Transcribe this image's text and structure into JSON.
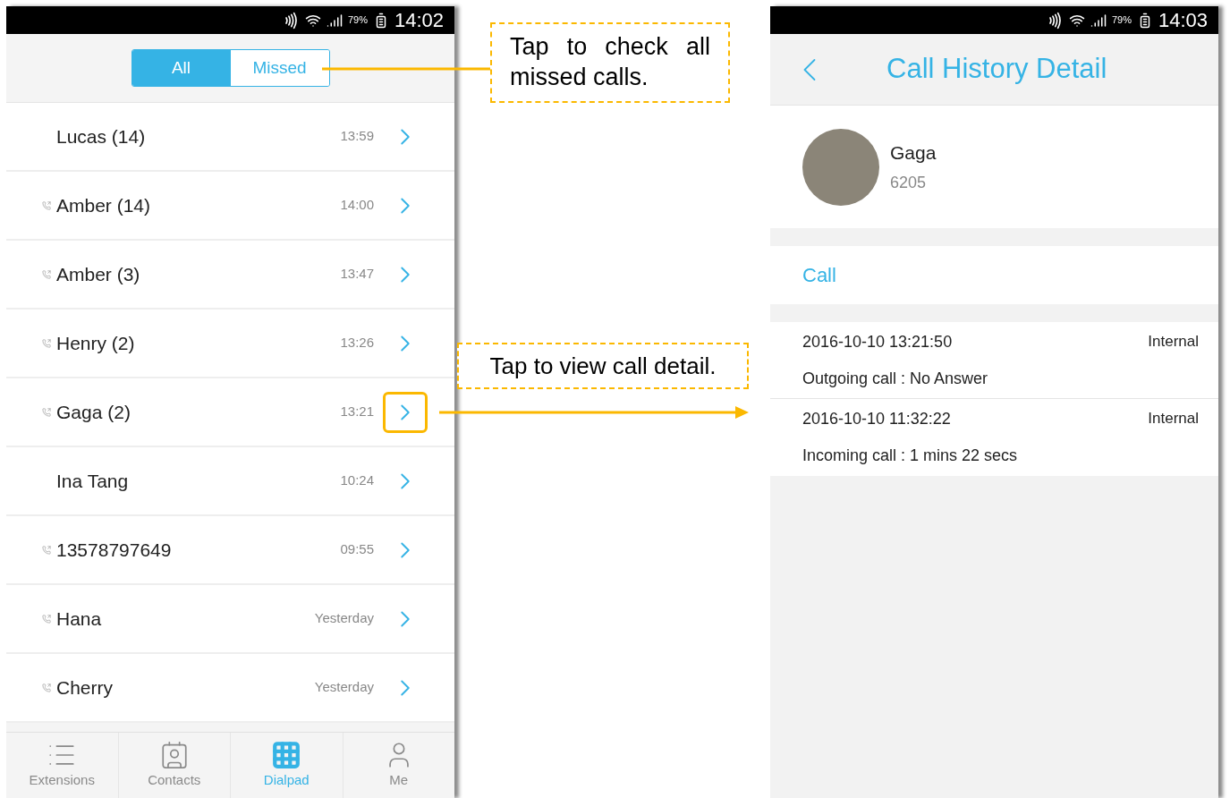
{
  "list_screen": {
    "status_bar": {
      "battery": "79%",
      "time": "14:02"
    },
    "filter_tabs": [
      {
        "label": "All",
        "selected": true
      },
      {
        "label": "Missed",
        "selected": false
      }
    ],
    "calls": [
      {
        "name": "Lucas (14)",
        "time": "13:59",
        "outgoing": false,
        "highlighted": false
      },
      {
        "name": "Amber (14)",
        "time": "14:00",
        "outgoing": true,
        "highlighted": false
      },
      {
        "name": "Amber (3)",
        "time": "13:47",
        "outgoing": true,
        "highlighted": false
      },
      {
        "name": "Henry (2)",
        "time": "13:26",
        "outgoing": true,
        "highlighted": false
      },
      {
        "name": "Gaga (2)",
        "time": "13:21",
        "outgoing": true,
        "highlighted": true
      },
      {
        "name": "Ina Tang",
        "time": "10:24",
        "outgoing": false,
        "highlighted": false
      },
      {
        "name": "13578797649",
        "time": "09:55",
        "outgoing": true,
        "highlighted": false
      },
      {
        "name": "Hana",
        "time": "Yesterday",
        "outgoing": true,
        "highlighted": false
      },
      {
        "name": "Cherry",
        "time": "Yesterday",
        "outgoing": true,
        "highlighted": false
      }
    ],
    "nav": [
      {
        "kind": "list",
        "label": "Extensions",
        "selected": false
      },
      {
        "kind": "contacts",
        "label": "Contacts",
        "selected": false
      },
      {
        "kind": "dialpad",
        "label": "Dialpad",
        "selected": true
      },
      {
        "kind": "person",
        "label": "Me",
        "selected": false
      }
    ]
  },
  "callouts": [
    {
      "text": "Tap to check all missed calls."
    },
    {
      "text": "Tap to view call detail."
    }
  ],
  "detail_screen": {
    "status_bar": {
      "battery": "79%",
      "time": "14:03"
    },
    "title": "Call History Detail",
    "contact": {
      "name": "Gaga",
      "extension": "6205"
    },
    "call_action": "Call",
    "records": [
      {
        "datetime": "2016-10-10 13:21:50",
        "type": "Internal",
        "summary": "Outgoing call : No Answer"
      },
      {
        "datetime": "2016-10-10 11:32:22",
        "type": "Internal",
        "summary": "Incoming call : 1 mins 22 secs"
      }
    ]
  }
}
